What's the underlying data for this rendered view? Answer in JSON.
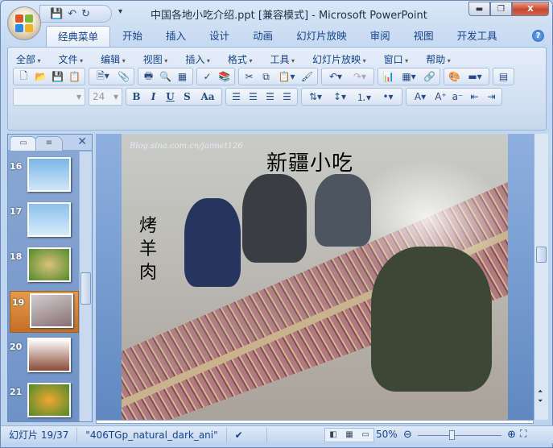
{
  "window": {
    "title": "中国各地小吃介绍.ppt [兼容模式] - Microsoft PowerPoint",
    "minimize": "▬",
    "maximize": "❐",
    "close": "X"
  },
  "quick_access": {
    "save": "💾",
    "undo": "↶",
    "redo": "↻",
    "more": "▾"
  },
  "tabs": [
    {
      "label": "经典菜单",
      "active": true
    },
    {
      "label": "开始"
    },
    {
      "label": "插入"
    },
    {
      "label": "设计"
    },
    {
      "label": "动画"
    },
    {
      "label": "幻灯片放映"
    },
    {
      "label": "审阅"
    },
    {
      "label": "视图"
    },
    {
      "label": "开发工具"
    }
  ],
  "help": "?",
  "menus": [
    "全部",
    "文件",
    "编辑",
    "视图",
    "插入",
    "格式",
    "工具",
    "幻灯片放映",
    "窗口",
    "帮助"
  ],
  "font": {
    "name": "",
    "size": "24"
  },
  "format_buttons": {
    "bold": "B",
    "italic": "I",
    "underline": "U",
    "shadow": "S",
    "case": "Aa"
  },
  "pane": {
    "tab_slides": "▭",
    "tab_outline": "≡",
    "close": "✕"
  },
  "thumbnails": [
    {
      "num": "16"
    },
    {
      "num": "17"
    },
    {
      "num": "18"
    },
    {
      "num": "19",
      "selected": true
    },
    {
      "num": "20"
    },
    {
      "num": "21"
    }
  ],
  "slide": {
    "watermark": "Blog.sina.com.cn/jannet126",
    "title": "新疆小吃",
    "vertical_text": "烤羊肉"
  },
  "status": {
    "slide": "幻灯片 19/37",
    "theme": "\"406TGp_natural_dark_ani\"",
    "zoom": "50%",
    "zoom_percent": 50
  }
}
